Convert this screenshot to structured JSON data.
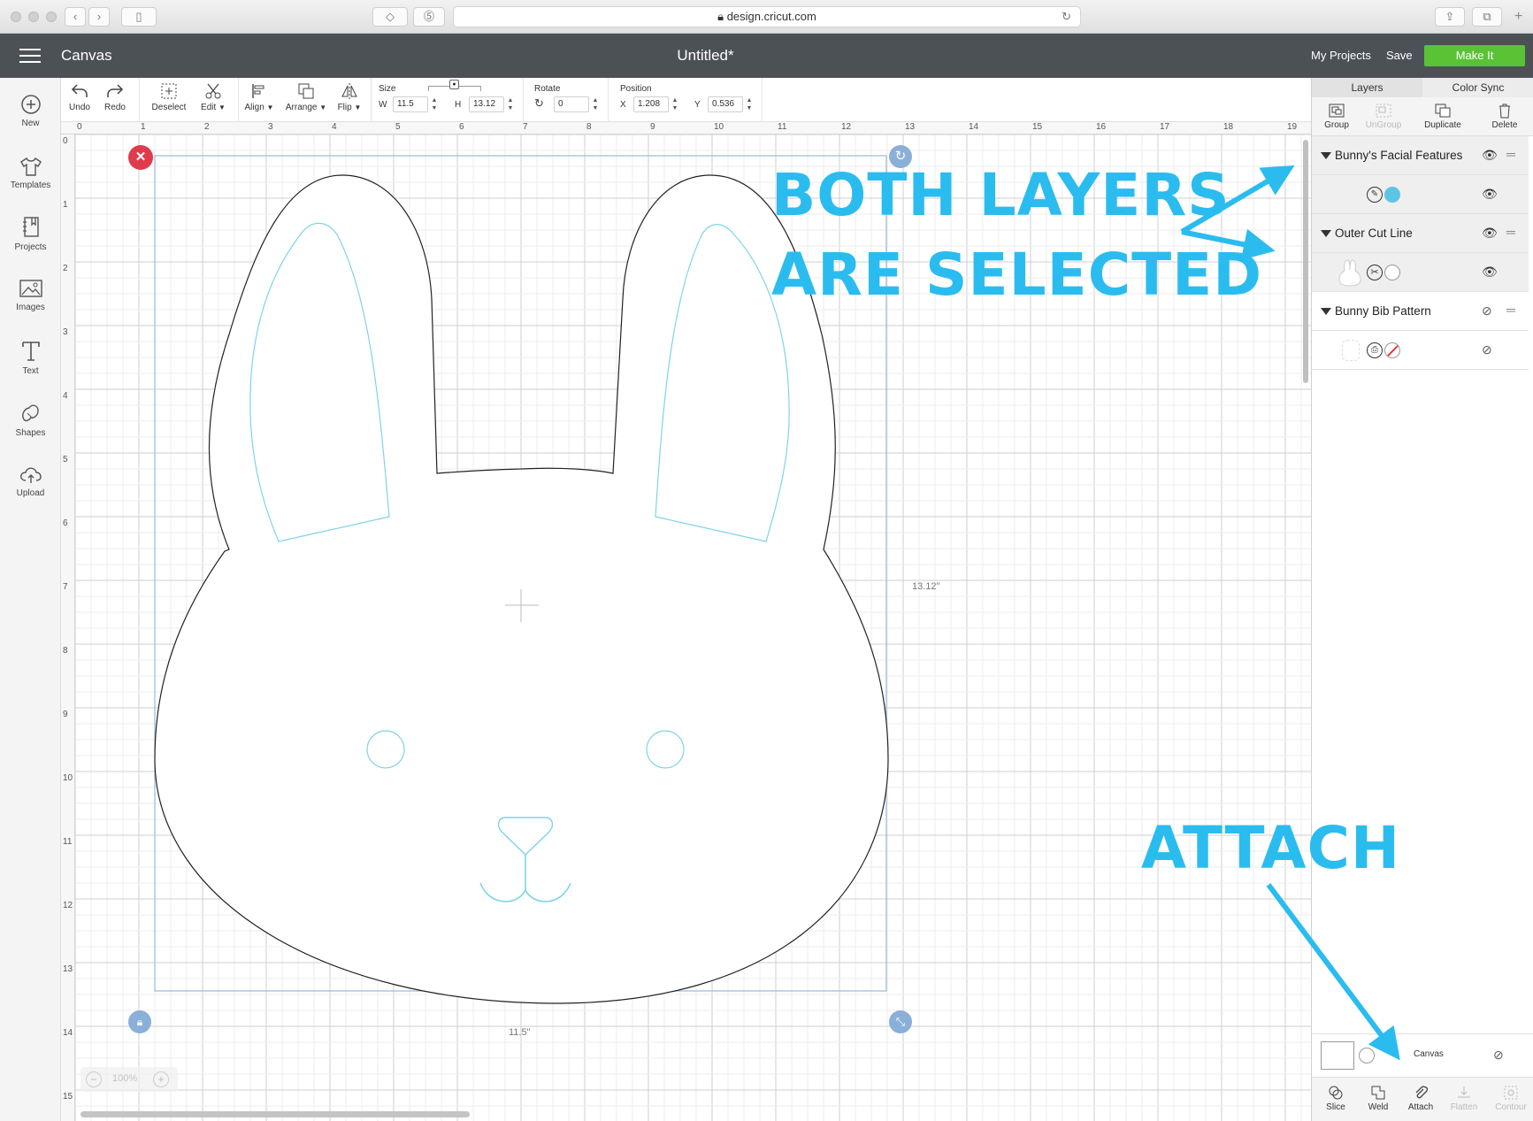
{
  "browser": {
    "url": "design.cricut.com"
  },
  "header": {
    "app_title": "Canvas",
    "doc_title": "Untitled*",
    "my_projects": "My Projects",
    "save": "Save",
    "make_it": "Make It"
  },
  "sidebar": {
    "items": [
      {
        "label": "New",
        "icon": "plus-circle-icon"
      },
      {
        "label": "Templates",
        "icon": "shirt-icon"
      },
      {
        "label": "Projects",
        "icon": "notebook-icon"
      },
      {
        "label": "Images",
        "icon": "image-icon"
      },
      {
        "label": "Text",
        "icon": "text-icon"
      },
      {
        "label": "Shapes",
        "icon": "shapes-icon"
      },
      {
        "label": "Upload",
        "icon": "cloud-upload-icon"
      }
    ]
  },
  "toolbar": {
    "undo": "Undo",
    "redo": "Redo",
    "deselect": "Deselect",
    "edit": "Edit",
    "align": "Align",
    "arrange": "Arrange",
    "flip": "Flip",
    "size_label": "Size",
    "w_label": "W",
    "w_value": "11.5",
    "h_label": "H",
    "h_value": "13.12",
    "rotate_label": "Rotate",
    "rotate_value": "0",
    "position_label": "Position",
    "x_label": "X",
    "x_value": "1.208",
    "y_label": "Y",
    "y_value": "0.536"
  },
  "canvas": {
    "ruler_top": [
      "0",
      "1",
      "2",
      "3",
      "4",
      "5",
      "6",
      "7",
      "8",
      "9",
      "10",
      "11",
      "12",
      "13",
      "14",
      "15",
      "16",
      "17",
      "18",
      "19"
    ],
    "ruler_left": [
      "0",
      "1",
      "2",
      "3",
      "4",
      "5",
      "6",
      "7",
      "8",
      "9",
      "10",
      "11",
      "12",
      "13",
      "14",
      "15"
    ],
    "height_dim": "13.12\"",
    "width_dim": "11.5\"",
    "zoom": "100%",
    "cut_color": "#222222",
    "draw_color": "#7fd3e8",
    "selection_color": "#7fa7cf"
  },
  "right_panel": {
    "tabs": [
      "Layers",
      "Color Sync"
    ],
    "tools": [
      {
        "label": "Group",
        "icon": "group-icon",
        "enabled": true
      },
      {
        "label": "UnGroup",
        "icon": "ungroup-icon",
        "enabled": false
      },
      {
        "label": "Duplicate",
        "icon": "duplicate-icon",
        "enabled": true
      },
      {
        "label": "Delete",
        "icon": "trash-icon",
        "enabled": true
      }
    ],
    "layers": [
      {
        "name": "Bunny's Facial Features",
        "visible": true,
        "sub_swatch": "#5bc5e6",
        "sub_op": "draw"
      },
      {
        "name": "Outer Cut Line",
        "visible": true,
        "sub_swatch": "#ffffff",
        "sub_op": "cut"
      },
      {
        "name": "Bunny Bib Pattern",
        "visible": false,
        "sub_swatch": "#ffffff",
        "sub_op": "print"
      }
    ],
    "canvas_row_label": "Canvas",
    "bottom_tools": [
      {
        "label": "Slice",
        "enabled": true
      },
      {
        "label": "Weld",
        "enabled": true
      },
      {
        "label": "Attach",
        "enabled": true
      },
      {
        "label": "Flatten",
        "enabled": false
      },
      {
        "label": "Contour",
        "enabled": false
      }
    ]
  },
  "annotations": {
    "line1": "BOTH LAYERS",
    "line2": "ARE SELECTED",
    "attach": "ATTACH",
    "color": "#2bbcef"
  }
}
